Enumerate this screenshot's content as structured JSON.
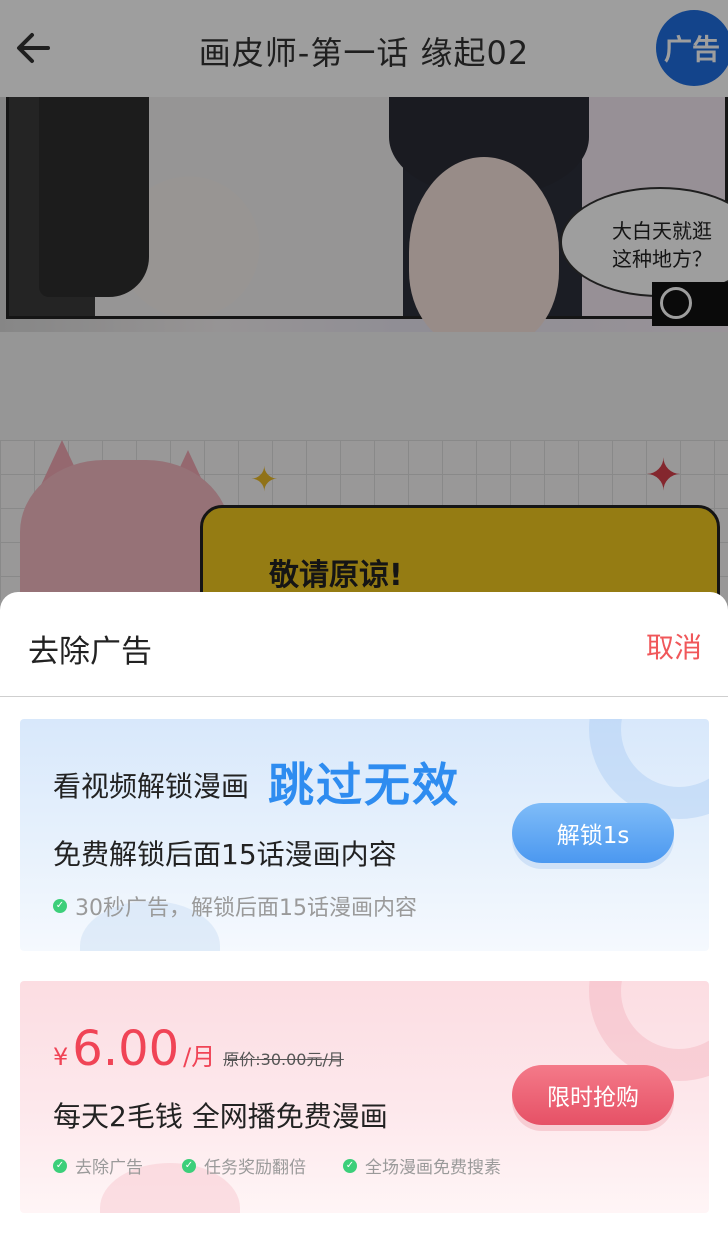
{
  "reader": {
    "title": "画皮师-第一话 缘起02",
    "ad_badge": "广告",
    "bubble_line1": "大白天就逛",
    "bubble_line2": "这种地方？",
    "apology": "敬请原谅!"
  },
  "sheet": {
    "title": "去除广告",
    "cancel": "取消"
  },
  "video_card": {
    "title": "看视频解锁漫画",
    "skip_label": "跳过无效",
    "subtitle": "免费解锁后面15话漫画内容",
    "feature": "30秒广告，解锁后面15话漫画内容",
    "button": "解锁1s"
  },
  "vip_card": {
    "currency": "¥",
    "price": "6.00",
    "unit": "/月",
    "original_price": "原价:30.00元/月",
    "subtitle": "每天2毛钱  全网播免费漫画",
    "features": [
      "去除广告",
      "任务奖励翻倍",
      "全场漫画免费搜素"
    ],
    "button": "限时抢购"
  },
  "colors": {
    "accent_blue": "#2e8cf0",
    "accent_red": "#f04456",
    "cancel_red": "#f0575a",
    "check_green": "#3ccf7a"
  }
}
